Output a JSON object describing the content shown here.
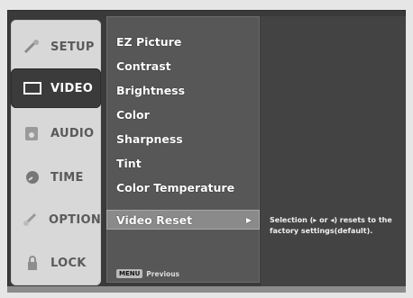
{
  "tabs": [
    {
      "label": "SETUP",
      "icon": "wrench-icon"
    },
    {
      "label": "VIDEO",
      "icon": "monitor-icon"
    },
    {
      "label": "AUDIO",
      "icon": "speaker-icon"
    },
    {
      "label": "TIME",
      "icon": "clock-icon"
    },
    {
      "label": "OPTION",
      "icon": "settings-icon"
    },
    {
      "label": "LOCK",
      "icon": "lock-icon"
    }
  ],
  "menu": {
    "items": [
      "EZ Picture",
      "Contrast",
      "Brightness",
      "Color",
      "Sharpness",
      "Tint",
      "Color Temperature",
      "Video Reset"
    ],
    "selected_arrow": "▶",
    "footer_badge": "MENU",
    "footer_label": "Previous"
  },
  "panel": {
    "description": "Selection (▸ or ◂) resets to the factory settings(default)."
  },
  "colors": {
    "frame": "#3a3a3a",
    "menu": "#575757",
    "selected": "#8a8a8a",
    "tabs": "#d8d8d8"
  }
}
